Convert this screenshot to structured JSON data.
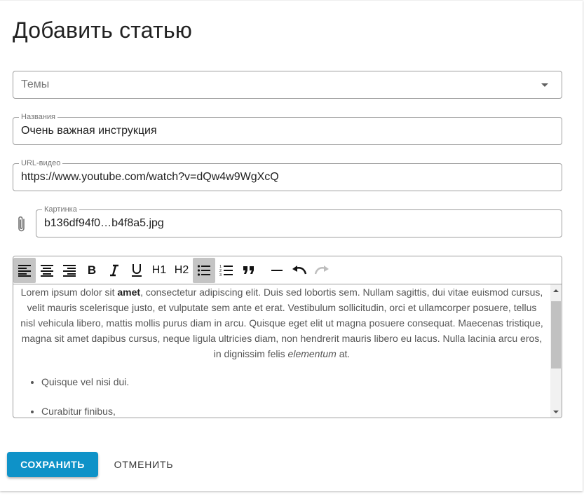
{
  "page": {
    "title": "Добавить статью"
  },
  "form": {
    "topics": {
      "placeholder": "Темы"
    },
    "name": {
      "label": "Названия",
      "value": "Очень важная инструкция"
    },
    "video": {
      "label": "URL-видео",
      "value": "https://www.youtube.com/watch?v=dQw4w9WgXcQ"
    },
    "image": {
      "label": "Картинка",
      "value": "b136df94f0…b4f8a5.jpg"
    }
  },
  "toolbar": {
    "bold": "B",
    "h1": "H1",
    "h2": "H2",
    "active_buttons": [
      "align-left",
      "bullet-list"
    ]
  },
  "editor": {
    "para_start": "Lorem ipsum dolor sit ",
    "para_bold": "amet",
    "para_mid": ", consectetur adipiscing elit. Duis sed lobortis sem. Nullam sagittis, dui vitae euismod cursus, velit mauris scelerisque justo, et vulputate sem ante et erat. Vestibulum sollicitudin, orci et ullamcorper posuere, tellus nisl vehicula libero, mattis mollis purus diam in arcu. Quisque eget elit ut magna posuere consequat. Maecenas tristique, magna sit amet dapibus cursus, neque ligula ultricies diam, non hendrerit mauris libero eu lacus. Nulla lacinia arcu eros, in dignissim felis ",
    "para_italic": "elementum",
    "para_end": " at.",
    "list": [
      "Quisque vel nisi dui.",
      "Curabitur finibus,"
    ]
  },
  "actions": {
    "save": "СОХРАНИТЬ",
    "cancel": "ОТМЕНИТЬ"
  },
  "colors": {
    "primary": "#0e92c8",
    "border": "#9e9e9e",
    "active_tool": "#c4c4c4"
  }
}
